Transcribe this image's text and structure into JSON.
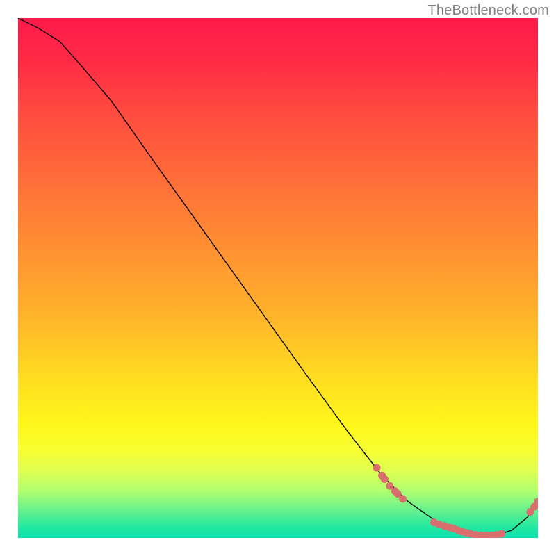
{
  "attribution": "TheBottleneck.com",
  "chart_data": {
    "type": "line",
    "title": "",
    "xlabel": "",
    "ylabel": "",
    "xlim": [
      0,
      100
    ],
    "ylim": [
      0,
      100
    ],
    "grid": false,
    "legend": false,
    "background": "rainbow-vertical-gradient",
    "series": [
      {
        "name": "bottleneck-curve",
        "x": [
          0,
          4,
          8,
          12,
          18,
          25,
          35,
          45,
          55,
          63,
          70,
          75,
          80,
          84,
          88,
          92,
          95,
          98,
          100
        ],
        "y": [
          100,
          98,
          95.5,
          91,
          84,
          74,
          60,
          46,
          32,
          21,
          12,
          7,
          3.5,
          1.5,
          0.5,
          0.5,
          1.5,
          4,
          7
        ],
        "color": "#000000"
      }
    ],
    "markers": [
      {
        "name": "curve-dot",
        "x": 69.0,
        "y": 13.5
      },
      {
        "name": "curve-dot",
        "x": 70.0,
        "y": 12.0
      },
      {
        "name": "curve-dot",
        "x": 70.5,
        "y": 11.3
      },
      {
        "name": "curve-dot",
        "x": 71.5,
        "y": 10.0
      },
      {
        "name": "curve-dot",
        "x": 72.5,
        "y": 9.0
      },
      {
        "name": "curve-dot",
        "x": 73.0,
        "y": 8.5
      },
      {
        "name": "curve-dot",
        "x": 74.0,
        "y": 7.5
      },
      {
        "name": "curve-dot",
        "x": 80.0,
        "y": 3.0
      },
      {
        "name": "curve-dot",
        "x": 81.0,
        "y": 2.6
      },
      {
        "name": "curve-dot",
        "x": 82.0,
        "y": 2.3
      },
      {
        "name": "curve-dot",
        "x": 83.0,
        "y": 2.0
      },
      {
        "name": "curve-dot",
        "x": 83.8,
        "y": 1.8
      },
      {
        "name": "curve-dot",
        "x": 84.6,
        "y": 1.5
      },
      {
        "name": "curve-dot",
        "x": 85.4,
        "y": 1.2
      },
      {
        "name": "curve-dot",
        "x": 86.2,
        "y": 1.0
      },
      {
        "name": "curve-dot",
        "x": 87.0,
        "y": 0.8
      },
      {
        "name": "curve-dot",
        "x": 88.0,
        "y": 0.6
      },
      {
        "name": "curve-dot",
        "x": 89.0,
        "y": 0.5
      },
      {
        "name": "curve-dot",
        "x": 90.0,
        "y": 0.5
      },
      {
        "name": "curve-dot",
        "x": 91.0,
        "y": 0.5
      },
      {
        "name": "curve-dot",
        "x": 92.0,
        "y": 0.6
      },
      {
        "name": "curve-dot",
        "x": 93.0,
        "y": 0.8
      },
      {
        "name": "curve-dot",
        "x": 98.5,
        "y": 5.0
      },
      {
        "name": "curve-dot",
        "x": 99.3,
        "y": 6.0
      },
      {
        "name": "curve-dot",
        "x": 100.0,
        "y": 7.0
      }
    ]
  }
}
